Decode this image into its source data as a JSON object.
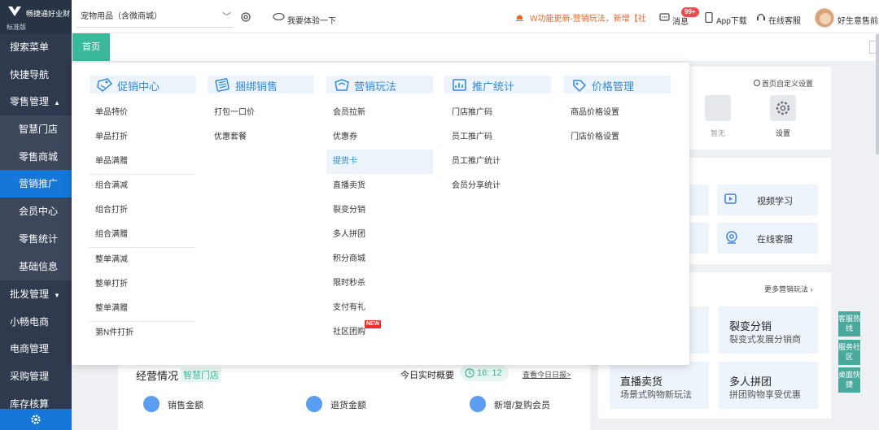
{
  "app": {
    "brand": "畅捷通好业财",
    "edition": "标准版"
  },
  "sidebar": {
    "items": [
      {
        "label": "搜索菜单"
      },
      {
        "label": "快捷导航"
      },
      {
        "label": "零售管理"
      },
      {
        "label": "智慧门店"
      },
      {
        "label": "零售商城"
      },
      {
        "label": "营销推广"
      },
      {
        "label": "会员中心"
      },
      {
        "label": "零售统计"
      },
      {
        "label": "基础信息"
      },
      {
        "label": "批发管理"
      },
      {
        "label": "小畅电商"
      },
      {
        "label": "电商管理"
      },
      {
        "label": "采购管理"
      },
      {
        "label": "库存核算"
      }
    ],
    "active": "营销推广"
  },
  "header": {
    "store_select": "宠物用品（含微商城）",
    "try_label": "我要体验一下",
    "notice": "W功能更新-营销玩法，新增【社",
    "messages_label": "消息",
    "messages_badge": "99+",
    "app_download": "App下载",
    "support": "在线客服",
    "user_name": "好生意售前"
  },
  "tabs": {
    "home": "首页"
  },
  "dashboard": {
    "customize": "首页自定义设置",
    "empty_label": "暂无",
    "settings_label": "设置",
    "video_learning": "视频学习",
    "online_support": "在线客服",
    "more_marketing": "更多营销玩法",
    "promos": [
      {
        "title": "裂变分销",
        "sub": "裂变式发展分销商"
      },
      {
        "title": "直播卖货",
        "sub": "场景式购物新玩法"
      },
      {
        "title": "多人拼团",
        "sub": "拼团购物享受优惠"
      }
    ],
    "biz_title": "经营情况",
    "biz_tag": "智慧门店",
    "realtime": "今日实时概要",
    "time": "16: 12",
    "view_daily": "查看今日日报>",
    "metrics": [
      "销售金额",
      "退货金额",
      "新增/复购会员"
    ]
  },
  "side_tabs": [
    "客服热线",
    "服务社区",
    "桌面快捷"
  ],
  "mega_menu": {
    "columns": [
      {
        "title": "促销中心",
        "icon": "promotion-icon",
        "items": [
          "单品特价",
          "单品打折",
          "单品满赠",
          "组合满减",
          "组合打折",
          "组合满赠",
          "整单满减",
          "整单打折",
          "整单满赠",
          "第N件打折"
        ]
      },
      {
        "title": "捆绑销售",
        "icon": "bundle-icon",
        "items": [
          "打包一口价",
          "优惠套餐"
        ]
      },
      {
        "title": "营销玩法",
        "icon": "marketing-icon",
        "items": [
          "会员拉新",
          "优惠券",
          "提货卡",
          "直播卖货",
          "裂变分销",
          "多人拼团",
          "积分商城",
          "限时秒杀",
          "支付有礼",
          "社区团购"
        ],
        "highlighted": "提货卡",
        "new_tag": "NEW"
      },
      {
        "title": "推广统计",
        "icon": "stats-icon",
        "items": [
          "门店推广码",
          "员工推广码",
          "员工推广统计",
          "会员分享统计"
        ]
      },
      {
        "title": "价格管理",
        "icon": "price-icon",
        "items": [
          "商品价格设置",
          "门店价格设置"
        ]
      }
    ]
  },
  "colors": {
    "sidebar_bg": "#2f3a4e",
    "active_blue": "#1677d8",
    "tab_green": "#3cb89c",
    "accent_blue": "#2f8ae5",
    "notice_orange": "#f0642c",
    "badge_red": "#f5474d"
  }
}
